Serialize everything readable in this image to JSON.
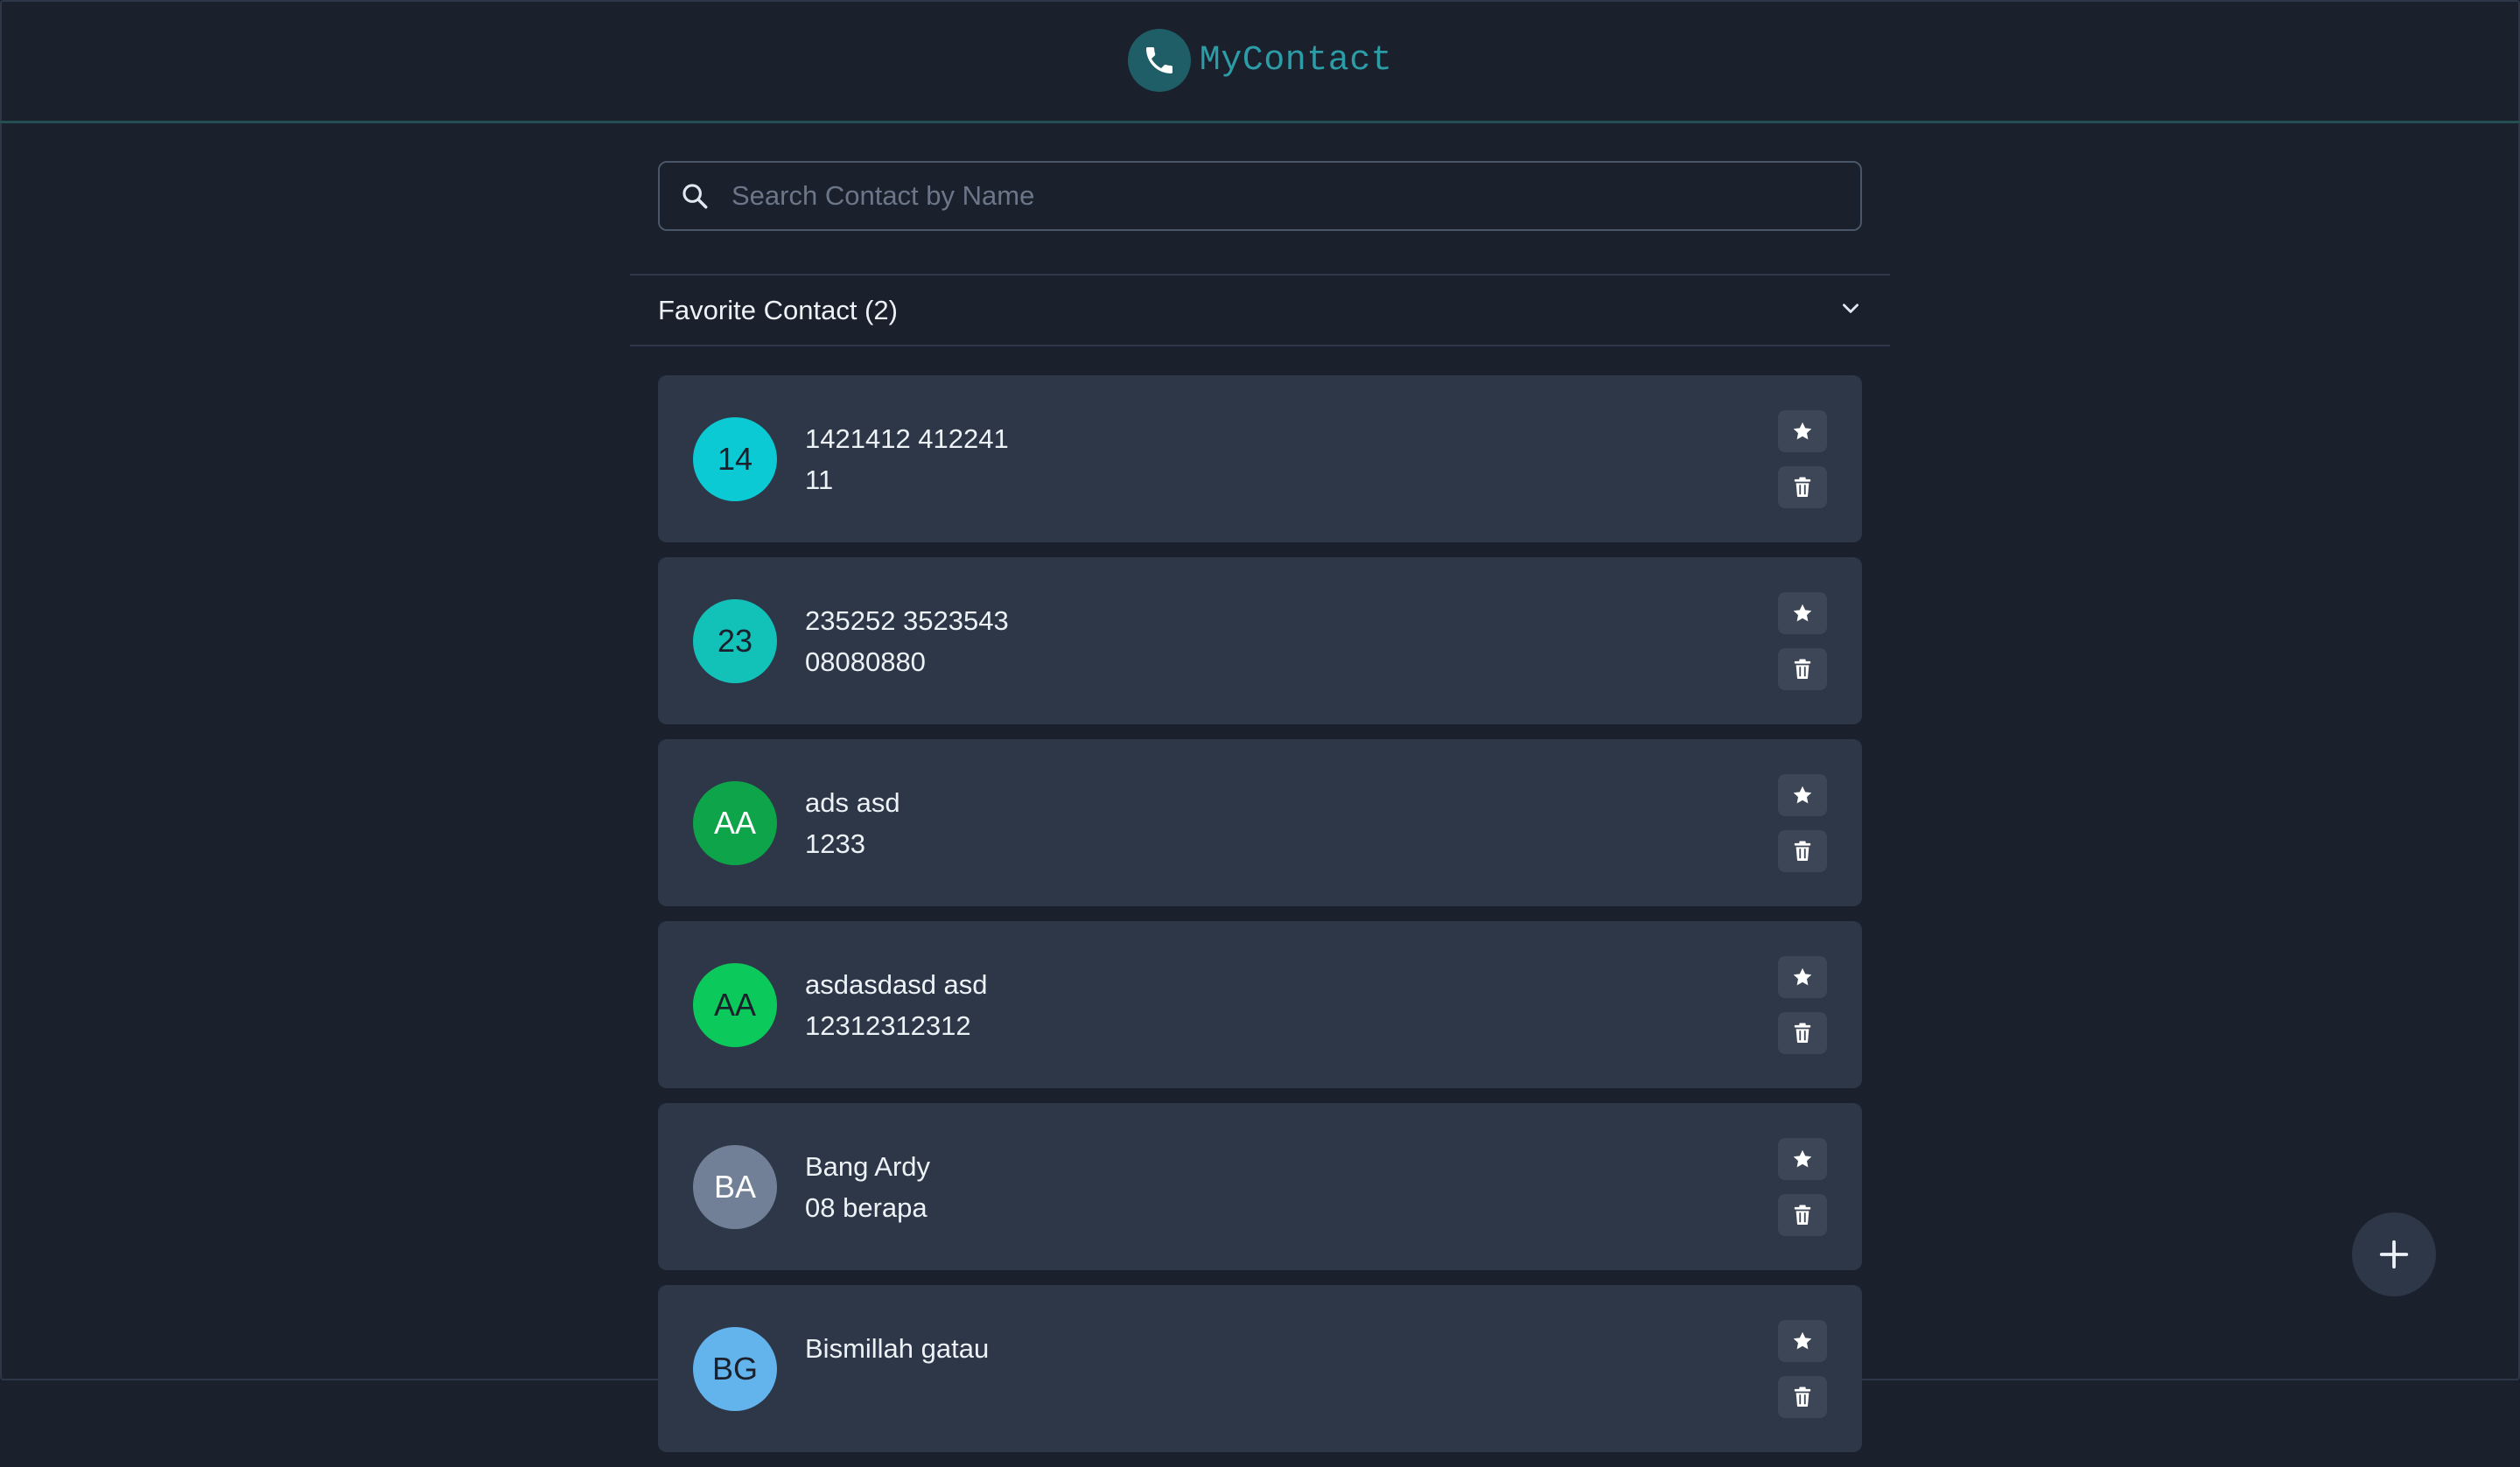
{
  "app": {
    "title": "MyContact"
  },
  "search": {
    "placeholder": "Search Contact by Name",
    "value": ""
  },
  "favorites": {
    "title": "Favorite Contact (2)",
    "expanded": false
  },
  "contacts": [
    {
      "initials": "14",
      "name": "1421412 412241",
      "phone": "11",
      "avatar_color": "#0bcad4",
      "initials_color": "#1a202c"
    },
    {
      "initials": "23",
      "name": "235252 3523543",
      "phone": "08080880",
      "avatar_color": "#12c1b8",
      "initials_color": "#1a202c"
    },
    {
      "initials": "AA",
      "name": "ads asd",
      "phone": "1233",
      "avatar_color": "#0ea44a",
      "initials_color": "#ffffff"
    },
    {
      "initials": "AA",
      "name": "asdasdasd asd",
      "phone": "12312312312",
      "avatar_color": "#0bc95a",
      "initials_color": "#1a202c"
    },
    {
      "initials": "BA",
      "name": "Bang Ardy",
      "phone": "08 berapa",
      "avatar_color": "#718096",
      "initials_color": "#ffffff"
    },
    {
      "initials": "BG",
      "name": "Bismillah gatau",
      "phone": "",
      "avatar_color": "#63b3ed",
      "initials_color": "#1a202c"
    }
  ],
  "icons": {
    "logo": "phone-icon",
    "search": "search-icon",
    "accordion": "chevron-down-icon",
    "favorite": "star-icon",
    "delete": "trash-icon",
    "add": "plus-icon"
  },
  "colors": {
    "background": "#1a202c",
    "card": "#2d3748",
    "accent": "#2c9ca6",
    "header_border": "#234e52"
  }
}
